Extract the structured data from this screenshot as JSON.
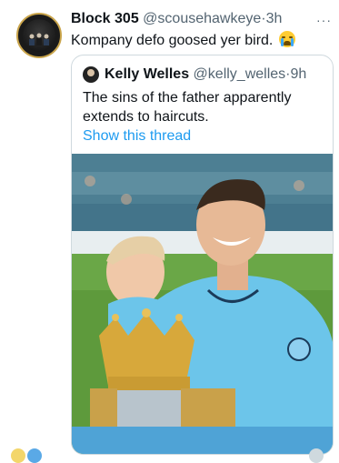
{
  "tweet": {
    "author_name": "Block 305",
    "author_handle": "@scousehawkeye",
    "separator": "·",
    "time": "3h",
    "text": "Kompany defo goosed yer bird.",
    "emoji": "loudly-crying-face",
    "more_icon": "ellipsis-icon",
    "more_label": "···"
  },
  "quoted_tweet": {
    "author_name": "Kelly Welles",
    "author_handle": "@kelly_welles",
    "separator": "·",
    "time": "9h",
    "text": "The sins of the father apparently extends to haircuts.",
    "thread_link": "Show this thread",
    "image": "photo-footballer-with-child-and-trophy"
  },
  "colors": {
    "link": "#1d9bf0",
    "secondary_text": "#536471",
    "border": "#cfd9de",
    "kit_blue": "#5bc0eb"
  }
}
